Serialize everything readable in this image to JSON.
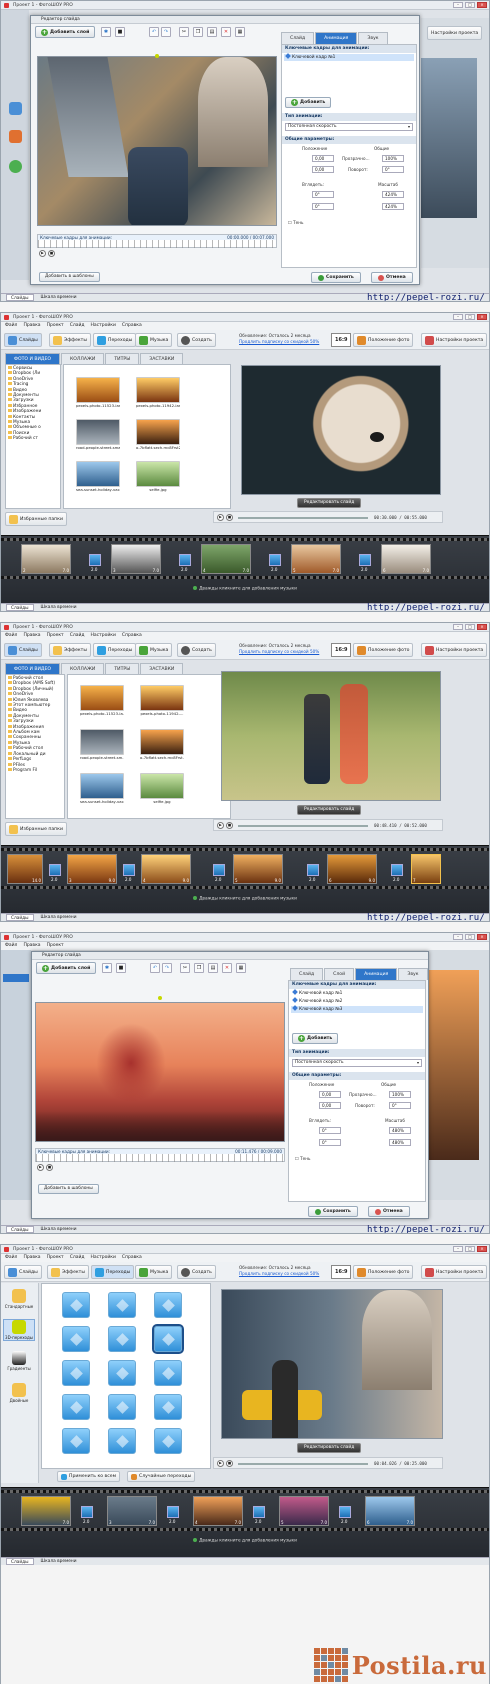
{
  "watermark": "http://pepel-rozi.ru/",
  "app": {
    "title": "Проект 1 - ФотоШОУ PRO",
    "menu": [
      "Файл",
      "Правка",
      "Проект",
      "Слайд",
      "Настройки",
      "Справка"
    ],
    "toolbar": {
      "slides_tab": "Слайды",
      "effects_tab": "Эффекты",
      "transitions_tab": "Переходы",
      "music": "Музыка",
      "create": "Создать"
    },
    "update_notice": "Обновление: Осталось 2 месяца",
    "update_link": "Продлить подписку со скидкой 50%",
    "ratio": "16:9",
    "photo_position": "Положение фото",
    "project_settings": "Настройки проекта",
    "edit_slide": "Редактировать слайд",
    "music_hint": "Дважды кликните для добавления музыки",
    "status_slides": "Слайды",
    "status_timeline": "Шкала времени",
    "colors": {
      "accent": "#2f76c9",
      "timeline": "#2b2f35"
    }
  },
  "library": {
    "tabs": [
      "ФОТО И ВИДЕО",
      "КОЛЛАЖИ",
      "ТИТРЫ",
      "ЗАСТАВКИ"
    ],
    "favorites": "Избранные папки",
    "folders_a": [
      "Сервисы",
      "Dropbox (Ли",
      "OneDrive",
      "Tracing",
      "Видео",
      "Документы",
      "Загрузки",
      "Избранное",
      "Изображени",
      "Контакты",
      "Музыка",
      "Объемные о",
      "Поиски",
      "Рабочий ст"
    ],
    "folders_b": [
      "Рабочий стол",
      "Dropbox (AMS Soft)",
      "Dropbox (Личный)",
      "OneDrive",
      "Юлия Яковлева",
      "Этот компьютер",
      "Видео",
      "Документы",
      "Загрузки",
      "Изображения",
      "Альбом кам",
      "Сохраненны",
      "Музыка",
      "Рабочий стол",
      "Локальный ди",
      "PerfLogs",
      "PFiles",
      "Program Fil"
    ],
    "thumbs_a": [
      "pexels-photo-11523-large...",
      "pexels-photo-11942-large...",
      "road-people-street-smartph...",
      "o-7bflatt.sech.mc8Frst2ZP...",
      "sea-sunset-holiday-vacatio...",
      "selfie.jpg"
    ],
    "thumbs_b": [
      "pexels-photo-11523-la...",
      "pexels-photo-11942-...",
      "road-people-street-sm...",
      "o-7bflatt.sech.mc8Frst...",
      "sea-sunset-holiday-vacati...",
      "selfie.jpg"
    ]
  },
  "player": {
    "time_2": "00:30.000 / 00:55.000",
    "time_3": "00:48.410 / 00:52.000"
  },
  "timeline_2": [
    {
      "num": "2",
      "dur": "7.0"
    },
    {
      "num": "3",
      "dur": "7.0"
    },
    {
      "num": "4",
      "dur": "7.0"
    },
    {
      "num": "5",
      "dur": "7.0"
    },
    {
      "num": "6",
      "dur": "7.0"
    }
  ],
  "timeline_3": [
    {
      "num": "",
      "dur": "14.0"
    },
    {
      "num": "3",
      "dur": "9.0"
    },
    {
      "num": "4",
      "dur": "9.0"
    },
    {
      "num": "5",
      "dur": "9.0"
    },
    {
      "num": "6",
      "dur": "9.0"
    },
    {
      "num": "7",
      "dur": ""
    }
  ],
  "timeline_5": [
    {
      "num": "",
      "dur": "7.0"
    },
    {
      "num": "3",
      "dur": "7.0"
    },
    {
      "num": "4",
      "dur": "7.0"
    },
    {
      "num": "5",
      "dur": "7.0"
    },
    {
      "num": "6",
      "dur": "7.0"
    }
  ],
  "transition_duration": "2.0",
  "editor": {
    "title": "Редактор слайда",
    "add_layer": "Добавить слой",
    "tabs_1": [
      "Слайд",
      "Анимация",
      "Звук"
    ],
    "tabs_4": [
      "Слайд",
      "Слой",
      "Анимация",
      "Звук"
    ],
    "keyframes_header": "Ключевые кадры для анимации:",
    "keyframes_1": [
      "Ключевой кадр №1"
    ],
    "keyframes_4": [
      "Ключевой кадр №1",
      "Ключевой кадр №2",
      "Ключевой кадр №3"
    ],
    "add": "Добавить",
    "anim_type_header": "Тип анимации:",
    "anim_type_value": "Постоянная скорость",
    "common_params": "Общие параметры:",
    "position": "Положение",
    "common": "Общие",
    "transparency": "Прозрачно...",
    "rotation": "Поворот:",
    "tilt": "Вглядеть:",
    "scale": "Масштаб",
    "shadow": "Тень",
    "x_pos": "0,00",
    "y_pos": "0,00",
    "opacity_1": "100%",
    "rot": "0°",
    "tilt_x": "0°",
    "tilt_y": "0°",
    "scale_x_1": "424%",
    "scale_y_1": "424%",
    "scale_x_4": "480%",
    "scale_y_4": "480%",
    "opacity_4": "100%",
    "save": "Сохранить",
    "cancel": "Отмена",
    "add_template": "Добавить в шаблоны",
    "kf_time_1": "00:00.000 / 00:07.000",
    "kf_time_4": "00:11.476 / 00:09.000"
  },
  "transitions": {
    "categories": [
      "Стандартные",
      "3D-переходы",
      "Градиенты",
      "Двойные"
    ],
    "apply_all": "Применить ко всем",
    "random": "Случайные переходы",
    "time": "00:04.026 / 00:25.000"
  },
  "logo": "Postila.ru"
}
